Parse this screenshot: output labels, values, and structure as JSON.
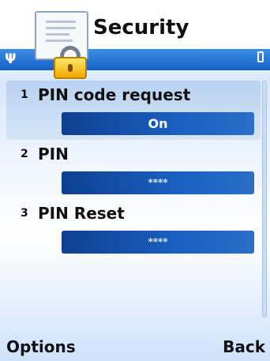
{
  "header": {
    "title": "Security",
    "icons": {
      "app": "security-lock-icon",
      "signal": "signal-icon",
      "battery": "battery-icon"
    }
  },
  "settings": [
    {
      "number": "1",
      "label": "PIN code request",
      "value": "On"
    },
    {
      "number": "2",
      "label": "PIN",
      "value": "****"
    },
    {
      "number": "3",
      "label": "PIN Reset",
      "value": "****"
    }
  ],
  "softkeys": {
    "left": "Options",
    "right": "Back"
  },
  "colors": {
    "accent": "#1660c8",
    "field": "#0d3f8f",
    "selection": "#b9d2f1"
  }
}
